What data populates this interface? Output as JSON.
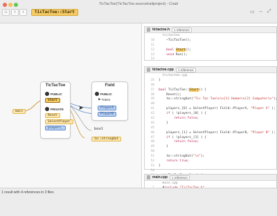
{
  "window": {
    "title": "TicTacToe(TicTacToe.sourcetrailproject) - Coati",
    "active_symbol": "TicTacToe::Start",
    "nav": {
      "home": "⌂",
      "back": "‹",
      "forward": "›",
      "refresh": "↻"
    },
    "right_icons": [
      "▭",
      "↔",
      "⤢"
    ]
  },
  "colors": {
    "function": "#f5c964",
    "field": "#b9d3f7",
    "edge": "#c99a3a"
  },
  "graph": {
    "class_node": {
      "name": "TicTacToe",
      "public_label": "PUBLIC",
      "private_label": "PRIVATE",
      "public_members": [
        "Start"
      ],
      "private_members": [
        "Reset",
        "SelectPlayer",
        "players_"
      ]
    },
    "field_node": {
      "name": "Field",
      "public_label": "PUBLIC",
      "members": [
        "Token",
        "PlayerA",
        "PlayerB"
      ]
    },
    "main_node": "main",
    "bool_node": "bool",
    "tostring_node": "to::stringOut"
  },
  "status": "1 result with 4 references in 3 files",
  "panels": [
    {
      "file": "tictactoe.h",
      "refs": "1 reference",
      "lines": [
        {
          "n": "",
          "t": "  tictactoe"
        },
        {
          "n": "10",
          "t": "    ~TicTacToe();"
        },
        {
          "n": "11",
          "t": ""
        },
        {
          "n": "12",
          "t": "    bool Start();"
        },
        {
          "n": "13",
          "t": "    void Run();"
        },
        {
          "n": "14",
          "t": ""
        }
      ]
    },
    {
      "file": "tictactoe.cpp",
      "refs": "1 reference",
      "lines": [
        {
          "n": "",
          "t": "  tictactoe.cpp"
        },
        {
          "n": "35",
          "t": "}"
        },
        {
          "n": "36",
          "t": ""
        },
        {
          "n": "37",
          "t": "bool TicTacToe::Start() {"
        },
        {
          "n": "38",
          "t": "    Reset();"
        },
        {
          "n": "39",
          "t": "    to::stringOut(\"Tic Tac Toe\\n\\n[1] Human\\n[2] Computer\\n\");"
        },
        {
          "n": "40",
          "t": ""
        },
        {
          "n": "41",
          "t": "    players_[0] = SelectPlayer( Field::PlayerA, \"Player A\" );"
        },
        {
          "n": "42",
          "t": "    if ( !players_[0] ) {"
        },
        {
          "n": "43",
          "t": "        return false;"
        },
        {
          "n": "44",
          "t": "    }"
        },
        {
          "n": "45",
          "t": ""
        },
        {
          "n": "46",
          "t": "    players_[1] = SelectPlayer( Field::PlayerB, \"Player B\" );"
        },
        {
          "n": "47",
          "t": "    if ( !players_[1] ) {"
        },
        {
          "n": "48",
          "t": "        return false;"
        },
        {
          "n": "49",
          "t": "    }"
        },
        {
          "n": "50",
          "t": ""
        },
        {
          "n": "51",
          "t": "    to::stringOut(\"\\n\");"
        },
        {
          "n": "52",
          "t": "    return true;"
        },
        {
          "n": "53",
          "t": "}"
        },
        {
          "n": "54",
          "t": ""
        },
        {
          "n": "55",
          "t": "void TicTacToe::Run() {"
        }
      ]
    },
    {
      "file": "main.cpp",
      "refs": "1 reference",
      "lines": [
        {
          "n": "",
          "t": "  main.cpp"
        },
        {
          "n": "1",
          "t": "  #include \"TicTacToe.h\""
        }
      ]
    }
  ]
}
